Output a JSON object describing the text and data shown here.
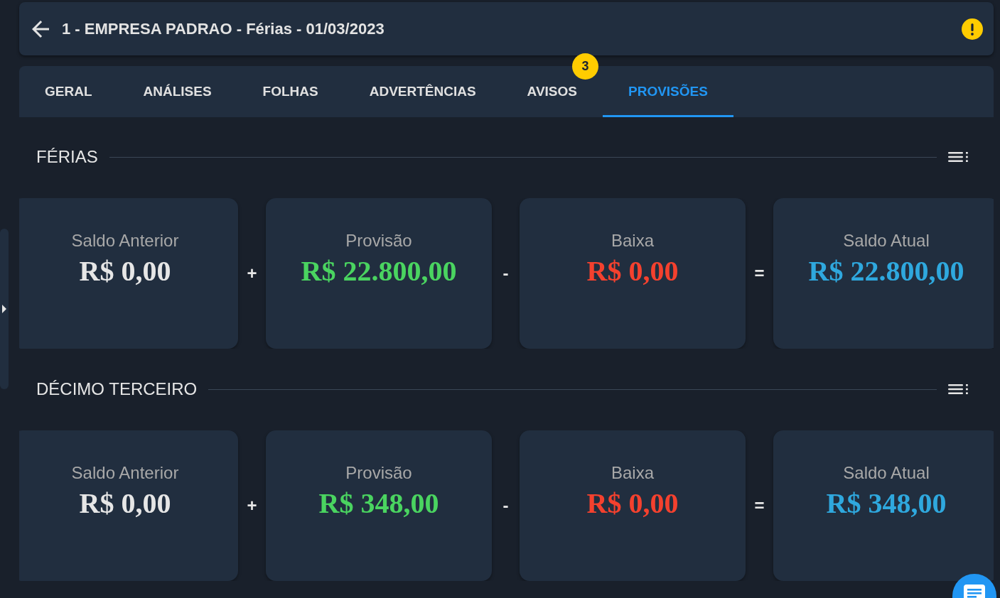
{
  "header": {
    "title": "1 - EMPRESA PADRAO - Férias - 01/03/2023"
  },
  "tabs": [
    {
      "label": "GERAL",
      "selected": false
    },
    {
      "label": "ANÁLISES",
      "selected": false
    },
    {
      "label": "FOLHAS",
      "selected": false
    },
    {
      "label": "ADVERTÊNCIAS",
      "selected": false
    },
    {
      "label": "AVISOS",
      "selected": false,
      "badge": "3"
    },
    {
      "label": "PROVISÕES",
      "selected": true
    }
  ],
  "sections": [
    {
      "title": "FÉRIAS",
      "cards": [
        {
          "label": "Saldo Anterior",
          "value": "R$ 0,00",
          "color": "#e6e6e6"
        },
        {
          "operator": "+",
          "label": "Provisão",
          "value": "R$ 22.800,00",
          "color": "#4ad460"
        },
        {
          "operator": "-",
          "label": "Baixa",
          "value": "R$ 0,00",
          "color": "#f4412e"
        },
        {
          "operator": "=",
          "label": "Saldo Atual",
          "value": "R$ 22.800,00",
          "color": "#2fa8de"
        }
      ]
    },
    {
      "title": "DÉCIMO TERCEIRO",
      "cards": [
        {
          "label": "Saldo Anterior",
          "value": "R$ 0,00",
          "color": "#e6e6e6"
        },
        {
          "operator": "+",
          "label": "Provisão",
          "value": "R$ 348,00",
          "color": "#4ad460"
        },
        {
          "operator": "-",
          "label": "Baixa",
          "value": "R$ 0,00",
          "color": "#f4412e"
        },
        {
          "operator": "=",
          "label": "Saldo Atual",
          "value": "R$ 348,00",
          "color": "#2fa8de"
        }
      ]
    }
  ]
}
